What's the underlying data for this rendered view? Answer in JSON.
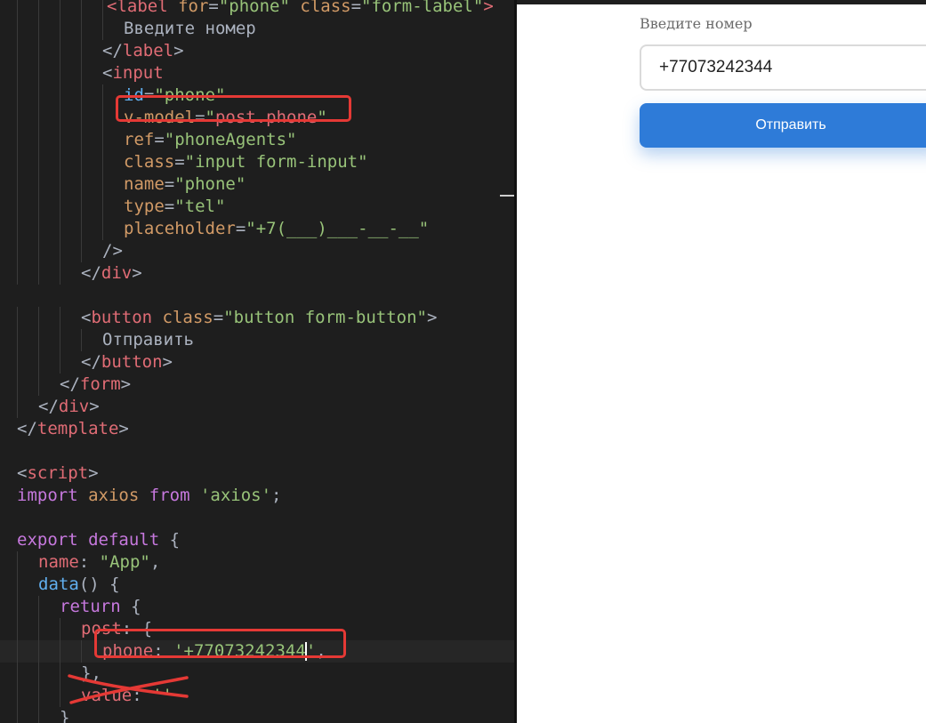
{
  "editor": {
    "lines": [
      {
        "indent": 120,
        "parts": [
          [
            "tag",
            "<label "
          ],
          [
            "attr",
            "for"
          ],
          [
            "punc",
            "="
          ],
          [
            "str",
            "\"phone\""
          ],
          [
            "punc",
            " "
          ],
          [
            "attr",
            "class"
          ],
          [
            "punc",
            "="
          ],
          [
            "str",
            "\"form-label\""
          ],
          [
            "tag",
            ">"
          ]
        ]
      },
      {
        "indent": 139,
        "parts": [
          [
            "text",
            "Введите номер"
          ]
        ]
      },
      {
        "indent": 115,
        "parts": [
          [
            "punc",
            "</"
          ],
          [
            "tag",
            "label"
          ],
          [
            "punc",
            ">"
          ]
        ]
      },
      {
        "indent": 115,
        "parts": [
          [
            "punc",
            "<"
          ],
          [
            "tag",
            "input"
          ]
        ]
      },
      {
        "indent": 139,
        "parts": [
          [
            "fn",
            "id"
          ],
          [
            "punc",
            "="
          ],
          [
            "str",
            "\"phone\""
          ]
        ]
      },
      {
        "indent": 139,
        "parts": [
          [
            "attr",
            "v-model"
          ],
          [
            "punc",
            "="
          ],
          [
            "str",
            "\""
          ],
          [
            "prop",
            "post.phone"
          ],
          [
            "str",
            "\""
          ]
        ]
      },
      {
        "indent": 139,
        "parts": [
          [
            "attr",
            "ref"
          ],
          [
            "punc",
            "="
          ],
          [
            "str",
            "\"phoneAgents\""
          ]
        ]
      },
      {
        "indent": 139,
        "parts": [
          [
            "attr",
            "class"
          ],
          [
            "punc",
            "="
          ],
          [
            "str",
            "\"input form-input\""
          ]
        ]
      },
      {
        "indent": 139,
        "parts": [
          [
            "attr",
            "name"
          ],
          [
            "punc",
            "="
          ],
          [
            "str",
            "\"phone\""
          ]
        ]
      },
      {
        "indent": 139,
        "parts": [
          [
            "attr",
            "type"
          ],
          [
            "punc",
            "="
          ],
          [
            "str",
            "\"tel\""
          ]
        ]
      },
      {
        "indent": 139,
        "parts": [
          [
            "attr",
            "placeholder"
          ],
          [
            "punc",
            "="
          ],
          [
            "str",
            "\"+7(___)___-__-__\""
          ]
        ]
      },
      {
        "indent": 115,
        "parts": [
          [
            "punc",
            "/>"
          ]
        ]
      },
      {
        "indent": 91,
        "parts": [
          [
            "punc",
            "</"
          ],
          [
            "tag",
            "div"
          ],
          [
            "punc",
            ">"
          ]
        ]
      },
      {
        "indent": 0,
        "parts": []
      },
      {
        "indent": 91,
        "parts": [
          [
            "punc",
            "<"
          ],
          [
            "tag",
            "button"
          ],
          [
            "punc",
            " "
          ],
          [
            "attr",
            "class"
          ],
          [
            "punc",
            "="
          ],
          [
            "str",
            "\"button form-button\""
          ],
          [
            "punc",
            ">"
          ]
        ]
      },
      {
        "indent": 115,
        "parts": [
          [
            "text",
            "Отправить"
          ]
        ]
      },
      {
        "indent": 91,
        "parts": [
          [
            "punc",
            "</"
          ],
          [
            "tag",
            "button"
          ],
          [
            "punc",
            ">"
          ]
        ]
      },
      {
        "indent": 67,
        "parts": [
          [
            "punc",
            "</"
          ],
          [
            "tag",
            "form"
          ],
          [
            "punc",
            ">"
          ]
        ]
      },
      {
        "indent": 43,
        "parts": [
          [
            "punc",
            "</"
          ],
          [
            "tag",
            "div"
          ],
          [
            "punc",
            ">"
          ]
        ]
      },
      {
        "indent": 19,
        "parts": [
          [
            "punc",
            "</"
          ],
          [
            "tag",
            "template"
          ],
          [
            "punc",
            ">"
          ]
        ]
      },
      {
        "indent": 0,
        "parts": []
      },
      {
        "indent": 19,
        "parts": [
          [
            "punc",
            "<"
          ],
          [
            "tag",
            "script"
          ],
          [
            "punc",
            ">"
          ]
        ]
      },
      {
        "indent": 19,
        "parts": [
          [
            "kw",
            "import"
          ],
          [
            "punc",
            " "
          ],
          [
            "attr",
            "axios"
          ],
          [
            "punc",
            " "
          ],
          [
            "kw",
            "from"
          ],
          [
            "punc",
            " "
          ],
          [
            "str",
            "'axios'"
          ],
          [
            "punc",
            ";"
          ]
        ]
      },
      {
        "indent": 0,
        "parts": []
      },
      {
        "indent": 19,
        "parts": [
          [
            "kw",
            "export"
          ],
          [
            "punc",
            " "
          ],
          [
            "kw",
            "default"
          ],
          [
            "punc",
            " {"
          ]
        ]
      },
      {
        "indent": 43,
        "parts": [
          [
            "prop",
            "name"
          ],
          [
            "punc",
            ": "
          ],
          [
            "str",
            "\"App\""
          ],
          [
            "punc",
            ","
          ]
        ]
      },
      {
        "indent": 43,
        "parts": [
          [
            "fn",
            "data"
          ],
          [
            "punc",
            "() {"
          ]
        ]
      },
      {
        "indent": 67,
        "parts": [
          [
            "kw",
            "return"
          ],
          [
            "punc",
            " {"
          ]
        ]
      },
      {
        "indent": 91,
        "parts": [
          [
            "prop",
            "post"
          ],
          [
            "punc",
            ": {"
          ]
        ]
      },
      {
        "indent": 115,
        "active": true,
        "cursor_after": 1,
        "parts": [
          [
            "prop",
            "phone"
          ],
          [
            "punc",
            ": "
          ],
          [
            "str",
            "'+77073242344"
          ],
          [
            "CURSOR",
            ""
          ],
          [
            "str",
            "'"
          ],
          [
            "punc",
            ","
          ]
        ]
      },
      {
        "indent": 91,
        "parts": [
          [
            "punc",
            "},"
          ]
        ]
      },
      {
        "indent": 91,
        "parts": [
          [
            "prop",
            "value"
          ],
          [
            "punc",
            ": "
          ],
          [
            "str",
            "''"
          ]
        ]
      },
      {
        "indent": 67,
        "parts": [
          [
            "punc",
            "}"
          ]
        ]
      }
    ]
  },
  "preview": {
    "label": "Введите номер",
    "phone_value": "+77073242344",
    "phone_placeholder": "+7(___)___-__-__",
    "submit_label": "Отправить"
  },
  "colors": {
    "highlight": "#e53935",
    "button": "#2e7bd8"
  }
}
